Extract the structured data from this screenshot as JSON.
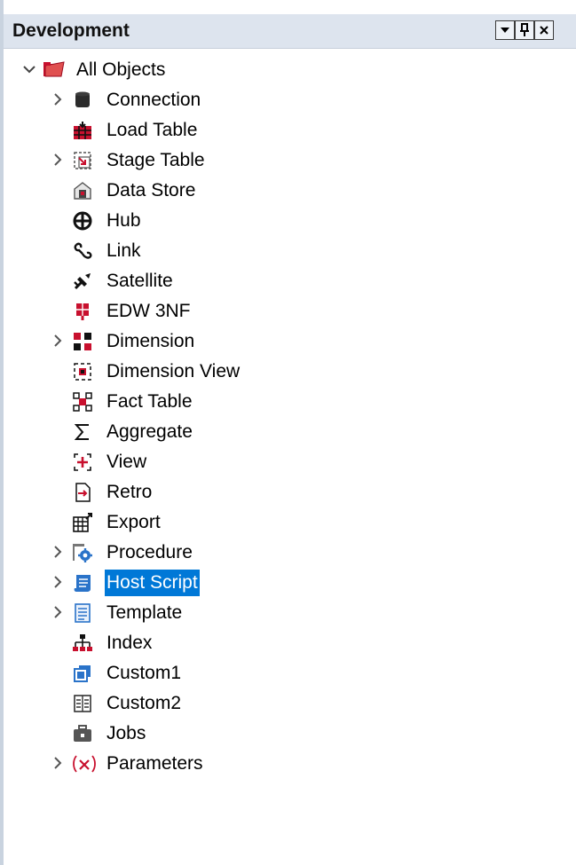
{
  "panel": {
    "title": "Development",
    "buttons": {
      "dropdown": "▾",
      "pin": "ᛒ",
      "close": "×"
    }
  },
  "tree": {
    "root": {
      "label": "All Objects",
      "expanded": true,
      "icon": "folder-open-icon"
    },
    "items": [
      {
        "label": "Connection",
        "expandable": true,
        "icon": "database-icon"
      },
      {
        "label": "Load Table",
        "expandable": false,
        "icon": "load-table-icon"
      },
      {
        "label": "Stage Table",
        "expandable": true,
        "icon": "stage-table-icon"
      },
      {
        "label": "Data Store",
        "expandable": false,
        "icon": "data-store-icon"
      },
      {
        "label": "Hub",
        "expandable": false,
        "icon": "hub-icon"
      },
      {
        "label": "Link",
        "expandable": false,
        "icon": "link-icon"
      },
      {
        "label": "Satellite",
        "expandable": false,
        "icon": "satellite-icon"
      },
      {
        "label": "EDW 3NF",
        "expandable": false,
        "icon": "edw-3nf-icon"
      },
      {
        "label": "Dimension",
        "expandable": true,
        "icon": "dimension-icon"
      },
      {
        "label": "Dimension View",
        "expandable": false,
        "icon": "dimension-view-icon"
      },
      {
        "label": "Fact Table",
        "expandable": false,
        "icon": "fact-table-icon"
      },
      {
        "label": "Aggregate",
        "expandable": false,
        "icon": "sigma-icon"
      },
      {
        "label": "View",
        "expandable": false,
        "icon": "view-icon"
      },
      {
        "label": "Retro",
        "expandable": false,
        "icon": "retro-icon"
      },
      {
        "label": "Export",
        "expandable": false,
        "icon": "export-icon"
      },
      {
        "label": "Procedure",
        "expandable": true,
        "icon": "procedure-icon"
      },
      {
        "label": "Host Script",
        "expandable": true,
        "icon": "host-script-icon",
        "selected": true
      },
      {
        "label": "Template",
        "expandable": true,
        "icon": "template-icon"
      },
      {
        "label": "Index",
        "expandable": false,
        "icon": "index-icon"
      },
      {
        "label": "Custom1",
        "expandable": false,
        "icon": "custom1-icon"
      },
      {
        "label": "Custom2",
        "expandable": false,
        "icon": "custom2-icon"
      },
      {
        "label": "Jobs",
        "expandable": false,
        "icon": "jobs-icon"
      },
      {
        "label": "Parameters",
        "expandable": true,
        "icon": "parameters-icon"
      }
    ]
  },
  "colors": {
    "selection": "#0078d7",
    "header": "#dde4ee",
    "icon_red": "#c8102e",
    "icon_blue": "#2a73c9"
  }
}
